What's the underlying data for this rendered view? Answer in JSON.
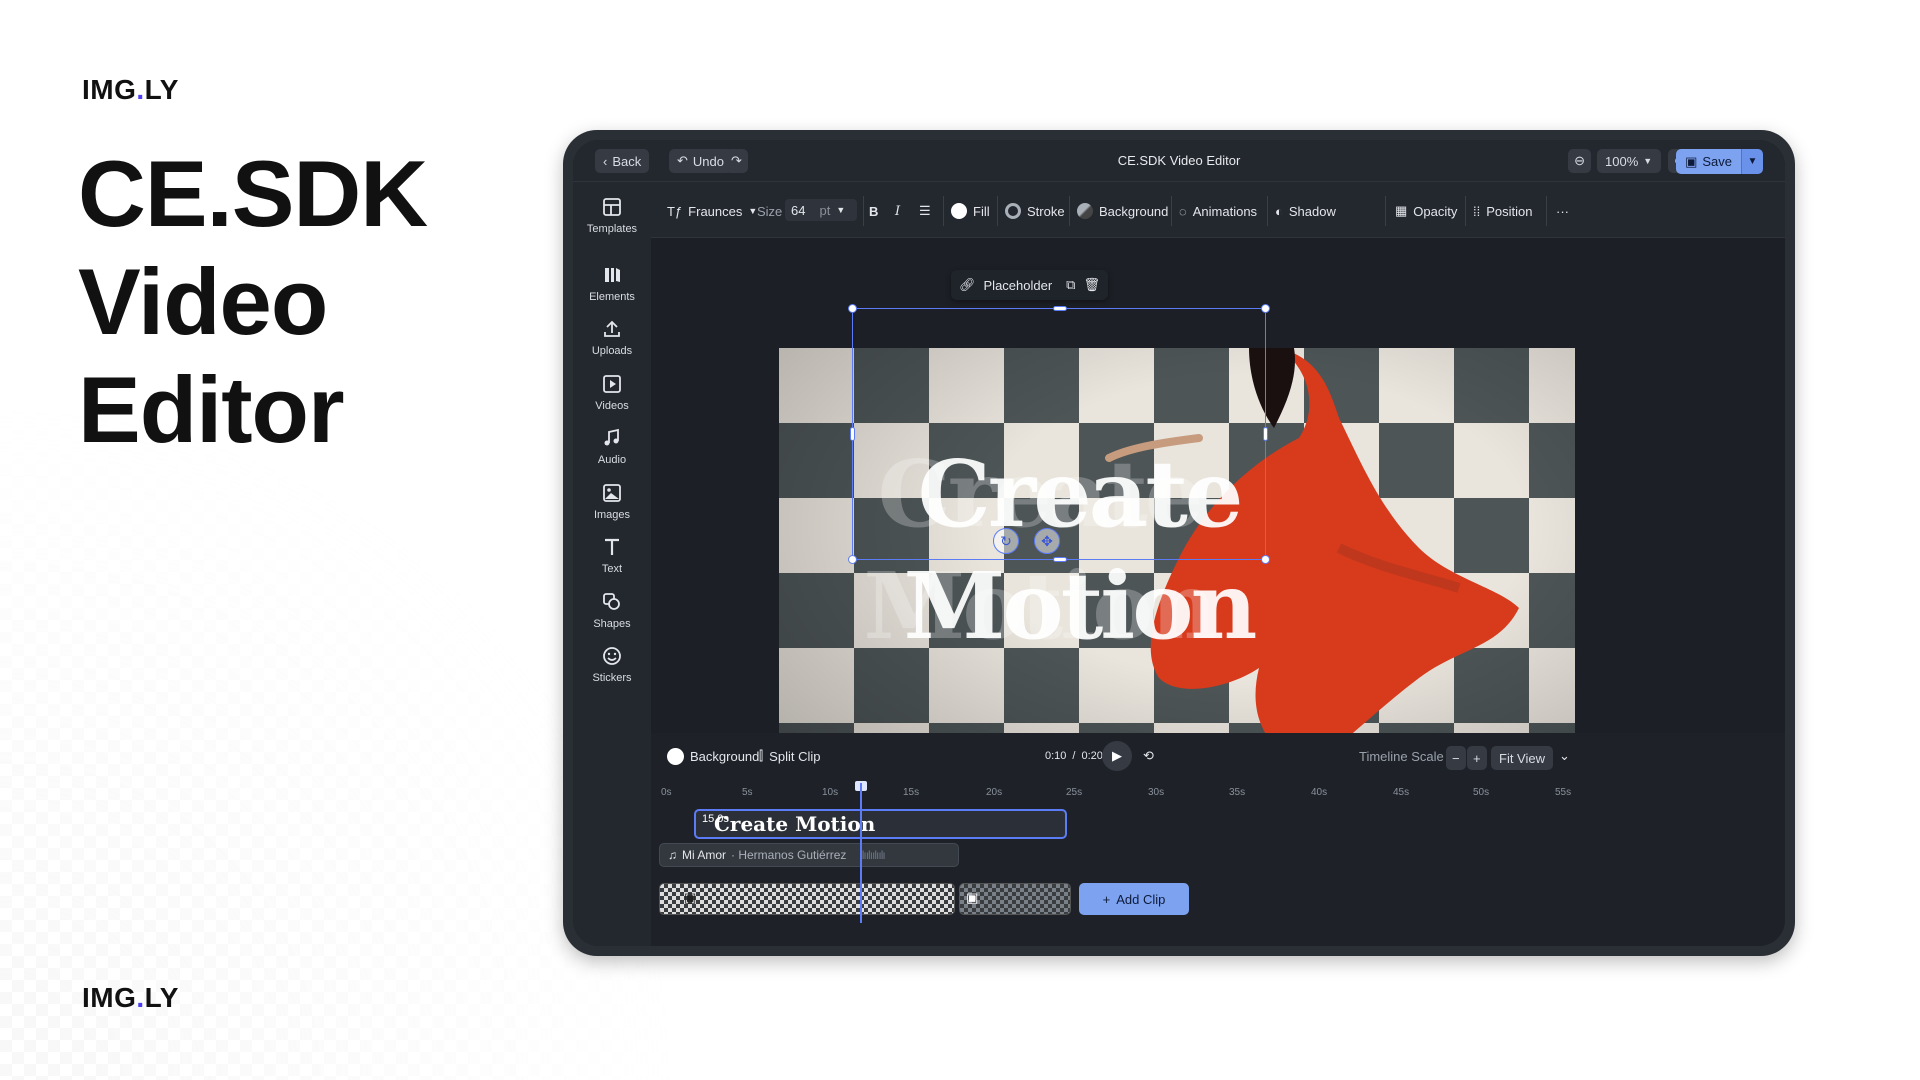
{
  "brand": {
    "logo_left": "IMG",
    "logo_dot": ".",
    "logo_right": "LY",
    "accent_color": "#4b3cf5"
  },
  "hero": {
    "line1": "CE.SDK",
    "line2": "Video",
    "line3": "Editor"
  },
  "topbar": {
    "back_label": "Back",
    "undo_label": "Undo",
    "title": "CE.SDK Video Editor",
    "zoom_value": "100%",
    "save_label": "Save"
  },
  "sidebar": {
    "items": [
      {
        "label": "Templates",
        "icon": "templates-icon"
      },
      {
        "label": "Elements",
        "icon": "elements-icon"
      },
      {
        "label": "Uploads",
        "icon": "upload-icon"
      },
      {
        "label": "Videos",
        "icon": "video-icon"
      },
      {
        "label": "Audio",
        "icon": "music-icon"
      },
      {
        "label": "Images",
        "icon": "image-icon"
      },
      {
        "label": "Text",
        "icon": "text-icon"
      },
      {
        "label": "Shapes",
        "icon": "shapes-icon"
      },
      {
        "label": "Stickers",
        "icon": "sticker-icon"
      }
    ]
  },
  "toolbar": {
    "font_name": "Fraunces",
    "size_label": "Size",
    "size_value": "64",
    "size_unit": "pt",
    "fill_label": "Fill",
    "stroke_label": "Stroke",
    "background_label": "Background",
    "animations_label": "Animations",
    "shadow_label": "Shadow",
    "opacity_label": "Opacity",
    "position_label": "Position"
  },
  "canvas": {
    "placeholder_label": "Placeholder",
    "headline_line1": "Create",
    "headline_line2": "Motion"
  },
  "timeline": {
    "background_label": "Background",
    "split_clip_label": "Split Clip",
    "time_current": "0:10",
    "time_separator": "/",
    "time_total": "0:20",
    "scale_label": "Timeline Scale",
    "fit_view_label": "Fit View",
    "ruler_labels": [
      "0s",
      "5s",
      "10s",
      "15s",
      "20s",
      "25s",
      "30s",
      "35s",
      "40s",
      "45s",
      "50s",
      "55s"
    ],
    "text_track_duration": "15.0s",
    "text_track_label": "Create Motion",
    "audio_track_title": "Mi Amor",
    "audio_track_artist": "· Hermanos Gutiérrez",
    "add_clip_label": "Add Clip"
  }
}
